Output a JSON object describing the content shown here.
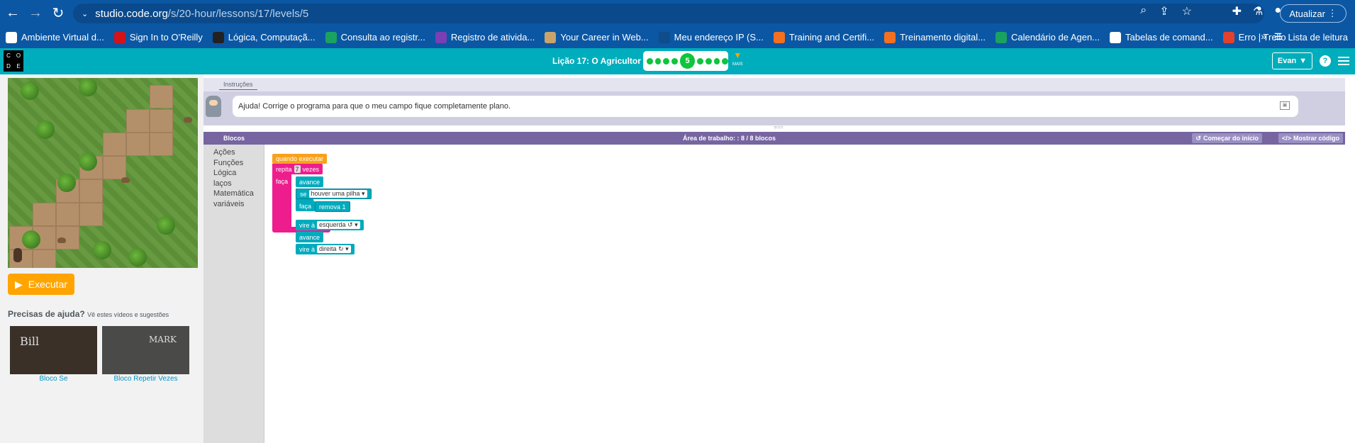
{
  "browser": {
    "url_host": "studio.code.org",
    "url_path": "/s/20-hour/lessons/17/levels/5",
    "update_label": "Atualizar",
    "bookmarks": [
      {
        "label": "Ambiente Virtual d...",
        "color": "#ffffff"
      },
      {
        "label": "Sign In to O'Reilly",
        "color": "#d3131a"
      },
      {
        "label": "Lógica, Computaçã...",
        "color": "#222222"
      },
      {
        "label": "Consulta ao registr...",
        "color": "#1aa260"
      },
      {
        "label": "Registro de ativida...",
        "color": "#7b3fb5"
      },
      {
        "label": "Your Career in Web...",
        "color": "#c9a46a"
      },
      {
        "label": "Meu endereço IP (S...",
        "color": "#0e4c8a"
      },
      {
        "label": "Training and Certifi...",
        "color": "#f37021"
      },
      {
        "label": "Treinamento digital...",
        "color": "#f37021"
      },
      {
        "label": "Calendário de Agen...",
        "color": "#1aa260"
      },
      {
        "label": "Tabelas de comand...",
        "color": "#ffffff"
      },
      {
        "label": "Erro | Trello",
        "color": "#e2412c"
      }
    ],
    "reading_list": "Lista de leitura",
    "more": "»"
  },
  "header": {
    "logo_letters": [
      "C",
      "O",
      "D",
      "E"
    ],
    "lesson_title": "Lição 17: O Agricultor 3",
    "current_level": "5",
    "more_label": "MAIS",
    "user_label": "Evan",
    "help": "?"
  },
  "left": {
    "run_label": "Executar",
    "help_title": "Precisas de ajuda?",
    "help_subtitle": "Vê estes vídeos e sugestões",
    "videos": [
      {
        "title_art": "Bill",
        "label": "Bloco Se"
      },
      {
        "title_art": "MARK",
        "label": "Bloco Repetir Vezes"
      }
    ]
  },
  "instructions": {
    "tab": "Instruções",
    "text": "Ajuda! Corrige o programa para que o meu campo fique completamente plano."
  },
  "workspace": {
    "blocks_header": "Blocos",
    "count_label": "Área de trabalho: : 8 / 8 blocos",
    "restart_label": "Começar do início",
    "show_code_label": "Mostrar código",
    "categories": [
      "Ações",
      "Funções",
      "Lógica",
      "laços",
      "Matemática",
      "variáveis"
    ],
    "program": {
      "when_run": "quando executar",
      "repeat": "repita",
      "repeat_count": "7",
      "times": "vezes",
      "do": "faça",
      "move1": "avance",
      "if": "se",
      "if_cond": "houver uma pilha ▾",
      "if_do": "faça",
      "remove": "remova 1",
      "turn1": "vire à",
      "turn1_dir": "esquerda ↺ ▾",
      "move2": "avance",
      "turn2": "vire à",
      "turn2_dir": "direita ↻ ▾"
    }
  }
}
